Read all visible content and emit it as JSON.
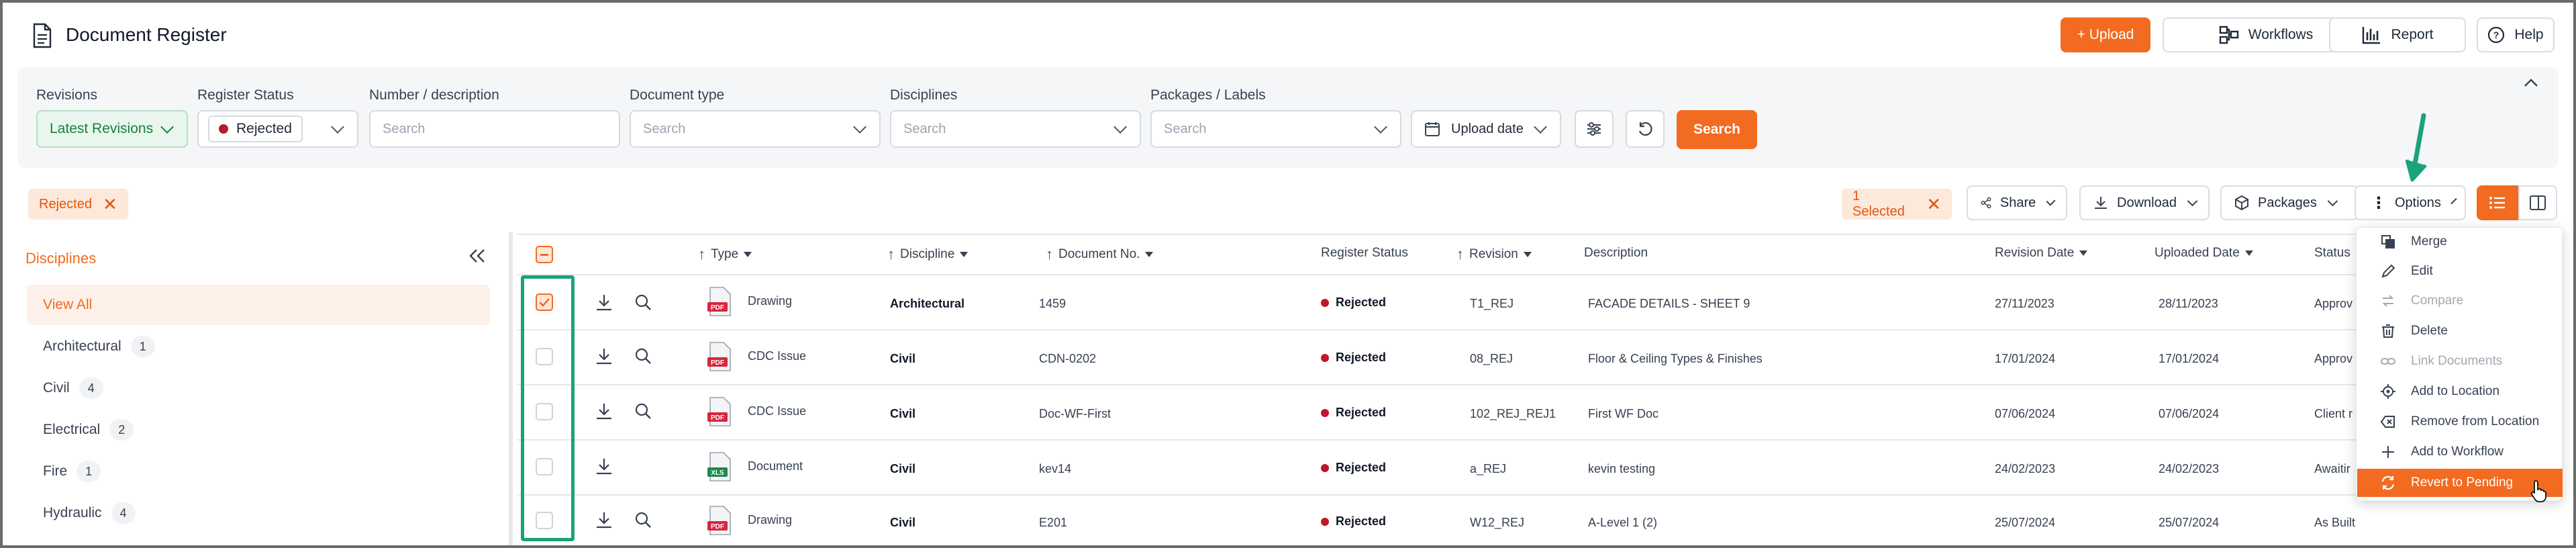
{
  "app": {
    "title": "Document Register"
  },
  "header": {
    "upload": "+ Upload",
    "workflows": "Workflows",
    "report": "Report",
    "help": "Help"
  },
  "filters": {
    "revisions": {
      "label": "Revisions",
      "value": "Latest Revisions"
    },
    "register_status": {
      "label": "Register Status",
      "value": "Rejected"
    },
    "number_desc": {
      "label": "Number / description",
      "placeholder": "Search"
    },
    "doc_type": {
      "label": "Document type",
      "placeholder": "Search"
    },
    "disciplines": {
      "label": "Disciplines",
      "placeholder": "Search"
    },
    "packages": {
      "label": "Packages / Labels",
      "placeholder": "Search"
    },
    "upload_date": "Upload date",
    "search_button": "Search"
  },
  "action_bar": {
    "active_filter_chip": "Rejected",
    "selected_chip": "1 Selected",
    "share": "Share",
    "download": "Download",
    "packages": "Packages",
    "options": "Options"
  },
  "sidebar": {
    "title": "Disciplines",
    "items": [
      {
        "label": "View All",
        "count": ""
      },
      {
        "label": "Architectural",
        "count": "1"
      },
      {
        "label": "Civil",
        "count": "4"
      },
      {
        "label": "Electrical",
        "count": "2"
      },
      {
        "label": "Fire",
        "count": "1"
      },
      {
        "label": "Hydraulic",
        "count": "4"
      }
    ]
  },
  "table": {
    "headers": {
      "type": "Type",
      "discipline": "Discipline",
      "doc_no": "Document No.",
      "register_status": "Register Status",
      "revision": "Revision",
      "description": "Description",
      "revision_date": "Revision Date",
      "uploaded_date": "Uploaded Date",
      "status": "Status"
    },
    "rows": [
      {
        "file": "PDF",
        "type": "Drawing",
        "discipline": "Architectural",
        "doc_no": "1459",
        "register_status": "Rejected",
        "revision": "T1_REJ",
        "description": "FACADE DETAILS - SHEET 9",
        "revision_date": "27/11/2023",
        "uploaded_date": "28/11/2023",
        "status": "Approv",
        "checked": true
      },
      {
        "file": "PDF",
        "type": "CDC Issue",
        "discipline": "Civil",
        "doc_no": "CDN-0202",
        "register_status": "Rejected",
        "revision": "08_REJ",
        "description": "Floor & Ceiling Types & Finishes",
        "revision_date": "17/01/2024",
        "uploaded_date": "17/01/2024",
        "status": "Approv",
        "checked": false
      },
      {
        "file": "PDF",
        "type": "CDC Issue",
        "discipline": "Civil",
        "doc_no": "Doc-WF-First",
        "register_status": "Rejected",
        "revision": "102_REJ_REJ1",
        "description": "First WF Doc",
        "revision_date": "07/06/2024",
        "uploaded_date": "07/06/2024",
        "status": "Client r",
        "checked": false
      },
      {
        "file": "XLS",
        "type": "Document",
        "discipline": "Civil",
        "doc_no": "kev14",
        "register_status": "Rejected",
        "revision": "a_REJ",
        "description": "kevin testing",
        "revision_date": "24/02/2023",
        "uploaded_date": "24/02/2023",
        "status": "Awaitir",
        "checked": false
      },
      {
        "file": "PDF",
        "type": "Drawing",
        "discipline": "Civil",
        "doc_no": "E201",
        "register_status": "Rejected",
        "revision": "W12_REJ",
        "description": "A-Level 1 (2)",
        "revision_date": "25/07/2024",
        "uploaded_date": "25/07/2024",
        "status": "As Built",
        "checked": false
      }
    ]
  },
  "options_menu": {
    "items": [
      {
        "label": "Merge",
        "icon": "merge-icon"
      },
      {
        "label": "Edit",
        "icon": "pencil-icon"
      },
      {
        "label": "Compare",
        "icon": "compare-icon",
        "disabled": true
      },
      {
        "label": "Delete",
        "icon": "trash-icon"
      },
      {
        "label": "Link Documents",
        "icon": "link-icon",
        "disabled": true
      },
      {
        "label": "Add to Location",
        "icon": "location-icon"
      },
      {
        "label": "Remove from Location",
        "icon": "remove-location-icon"
      },
      {
        "label": "Add to Workflow",
        "icon": "plus-icon"
      },
      {
        "label": "Revert to Pending",
        "icon": "refresh-icon",
        "highlighted": true
      }
    ]
  },
  "colors": {
    "accent": "#f26b21",
    "rejected": "#c0152a",
    "annotation_green": "#1aa37a"
  }
}
